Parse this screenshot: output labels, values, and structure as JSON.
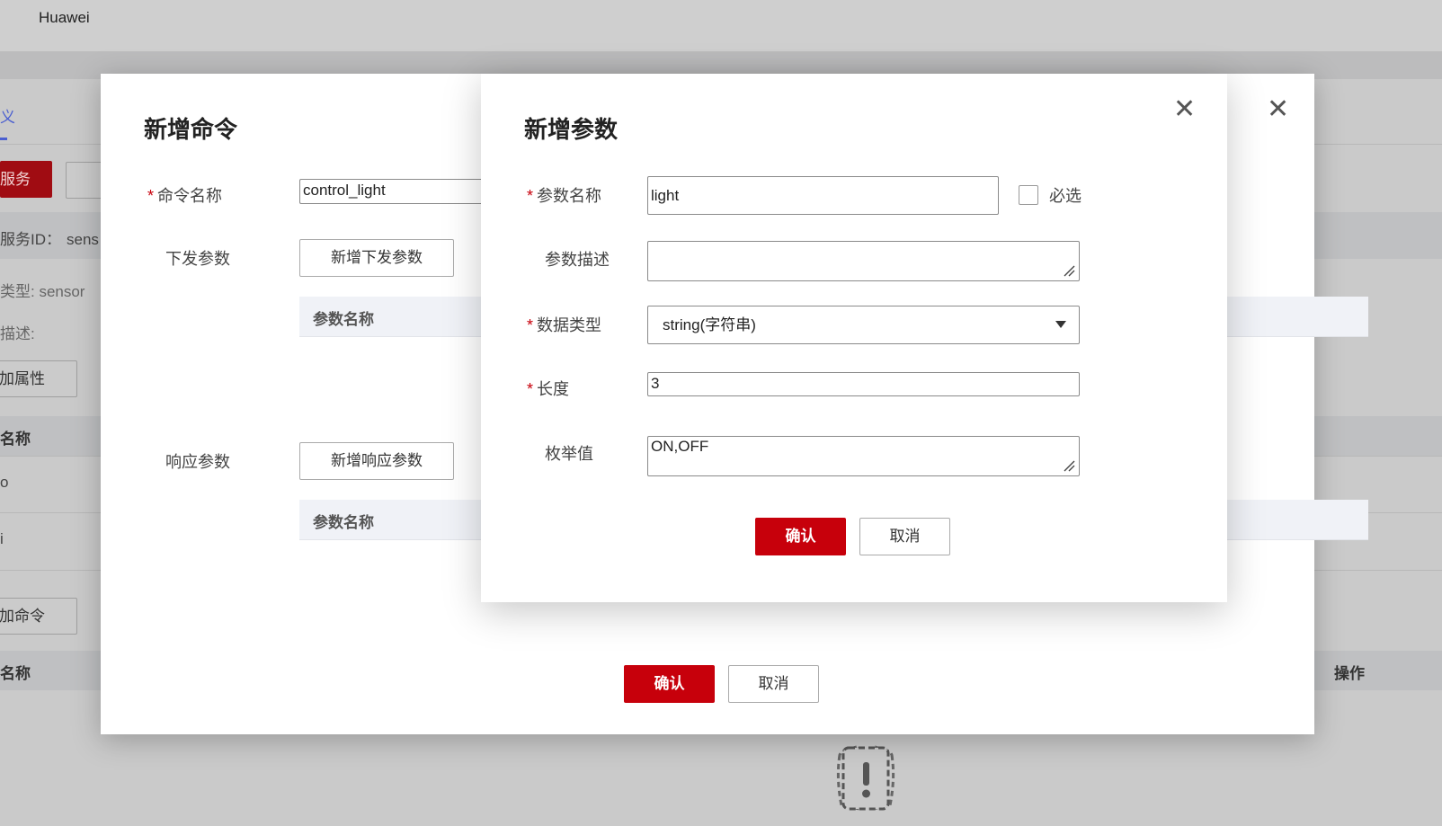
{
  "background": {
    "brand": "Huawei",
    "tab_fragment": "义",
    "red_button_fragment": "服务",
    "service_id_label": "服务ID：",
    "service_id_value": "sens",
    "type_fragment": "类型: sensor",
    "desc_fragment": "描述:",
    "add_property_fragment": "加属性",
    "name_header_fragment": "名称",
    "row1_fragment": "o",
    "row2_fragment": "i",
    "add_command_fragment": "加命令",
    "name_header2_fragment": "名称",
    "operation_header": "操作"
  },
  "modal_command": {
    "title": "新增命令",
    "command_name_label": "命令名称",
    "command_name_value": "control_light",
    "issue_params_label": "下发参数",
    "add_issue_param_button": "新增下发参数",
    "issue_table_header": "参数名称",
    "response_params_label": "响应参数",
    "add_response_param_button": "新增响应参数",
    "response_table_header": "参数名称",
    "confirm_button": "确认",
    "cancel_button": "取消"
  },
  "modal_param": {
    "title": "新增参数",
    "param_name_label": "参数名称",
    "param_name_value": "light",
    "required_label": "必选",
    "required_checked": false,
    "param_desc_label": "参数描述",
    "param_desc_value": "",
    "data_type_label": "数据类型",
    "data_type_value": "string(字符串)",
    "length_label": "长度",
    "length_value": "3",
    "enum_label": "枚举值",
    "enum_value": "ON,OFF",
    "confirm_button": "确认",
    "cancel_button": "取消"
  },
  "icons": {
    "close": "close-icon",
    "dropdown": "chevron-down-icon",
    "empty": "empty-state-icon",
    "resize": "resize-grip-icon"
  },
  "colors": {
    "primary": "#c7000b",
    "overlay": "#c9c9c9"
  }
}
